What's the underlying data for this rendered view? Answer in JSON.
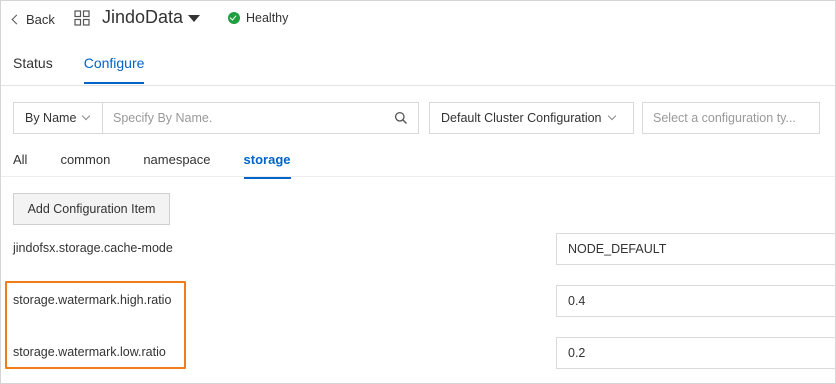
{
  "header": {
    "back_label": "Back",
    "app_title": "JindoData",
    "health_status": "Healthy",
    "health_color": "#1e9e3e"
  },
  "main_tabs": [
    {
      "label": "Status",
      "active": false
    },
    {
      "label": "Configure",
      "active": true
    }
  ],
  "filters": {
    "search_mode": "By Name",
    "search_placeholder": "Specify By Name.",
    "cluster_config": "Default Cluster Configuration",
    "type_placeholder": "Select a configuration ty..."
  },
  "sub_tabs": [
    {
      "label": "All",
      "active": false
    },
    {
      "label": "common",
      "active": false
    },
    {
      "label": "namespace",
      "active": false
    },
    {
      "label": "storage",
      "active": true
    }
  ],
  "add_button_label": "Add Configuration Item",
  "config_items": [
    {
      "key": "jindofsx.storage.cache-mode",
      "value": "NODE_DEFAULT"
    },
    {
      "key": "storage.watermark.high.ratio",
      "value": "0.4"
    },
    {
      "key": "storage.watermark.low.ratio",
      "value": "0.2"
    }
  ],
  "colors": {
    "accent": "#0064c8",
    "highlight": "#f07d1a"
  }
}
